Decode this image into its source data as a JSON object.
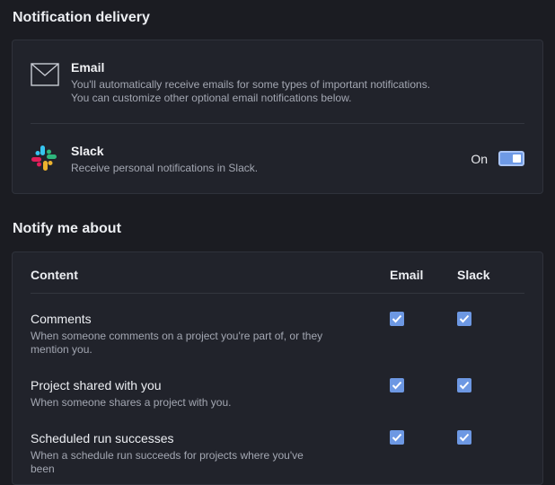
{
  "delivery": {
    "title": "Notification delivery",
    "email": {
      "title": "Email",
      "description": "You'll automatically receive emails for some types of important notifications. You can customize other optional email notifications below."
    },
    "slack": {
      "title": "Slack",
      "description": "Receive personal notifications in Slack.",
      "toggle_label": "On",
      "enabled": true
    }
  },
  "notify": {
    "title": "Notify me about",
    "headers": {
      "content": "Content",
      "email": "Email",
      "slack": "Slack"
    },
    "rows": [
      {
        "title": "Comments",
        "description": "When someone comments on a project you're part of, or they mention you.",
        "email": true,
        "slack": true
      },
      {
        "title": "Project shared with you",
        "description": "When someone shares a project with you.",
        "email": true,
        "slack": true
      },
      {
        "title": "Scheduled run successes",
        "description": "When a schedule run succeeds for projects where you've been",
        "email": true,
        "slack": true
      }
    ]
  },
  "colors": {
    "accent": "#6d98e3",
    "background": "#1b1c22",
    "card": "#21232b"
  }
}
